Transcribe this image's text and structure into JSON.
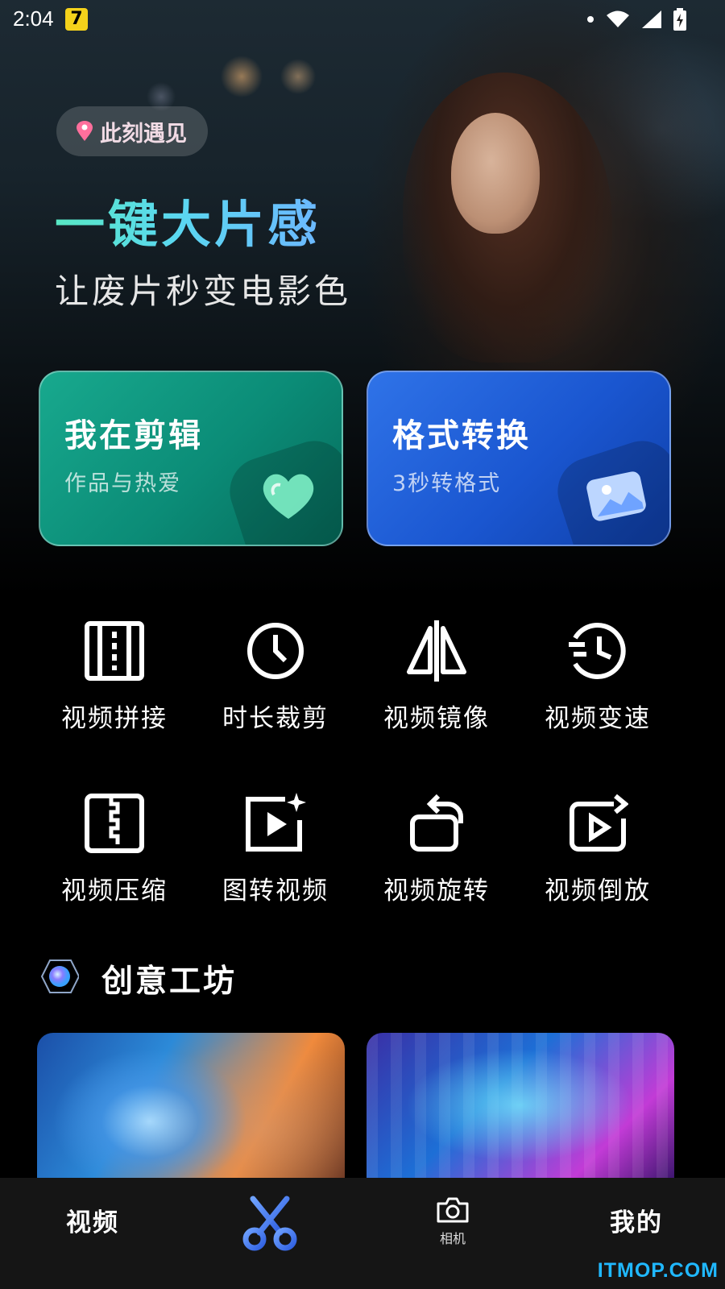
{
  "status_bar": {
    "time": "2:04",
    "app_badge": "7"
  },
  "hero": {
    "tag": "此刻遇见",
    "headline": "一键大片感",
    "subline": "让废片秒变电影色"
  },
  "cards": {
    "edit": {
      "title": "我在剪辑",
      "subtitle": "作品与热爱"
    },
    "convert": {
      "title": "格式转换",
      "subtitle": "3秒转格式"
    }
  },
  "tools": [
    {
      "label": "视频拼接",
      "icon": "film-splice-icon"
    },
    {
      "label": "时长裁剪",
      "icon": "clock-icon"
    },
    {
      "label": "视频镜像",
      "icon": "mirror-icon"
    },
    {
      "label": "视频变速",
      "icon": "speed-clock-icon"
    },
    {
      "label": "视频压缩",
      "icon": "zip-compress-icon"
    },
    {
      "label": "图转视频",
      "icon": "image-to-video-icon"
    },
    {
      "label": "视频旋转",
      "icon": "rotate-icon"
    },
    {
      "label": "视频倒放",
      "icon": "reverse-play-icon"
    }
  ],
  "section": {
    "title": "创意工坊"
  },
  "bottom_nav": {
    "video": "视频",
    "camera": "相机",
    "me": "我的"
  },
  "watermark": "ITMOP.COM",
  "colors": {
    "accent_teal": "#18a98e",
    "accent_blue": "#2f73e8",
    "nav_bg": "#151515"
  }
}
